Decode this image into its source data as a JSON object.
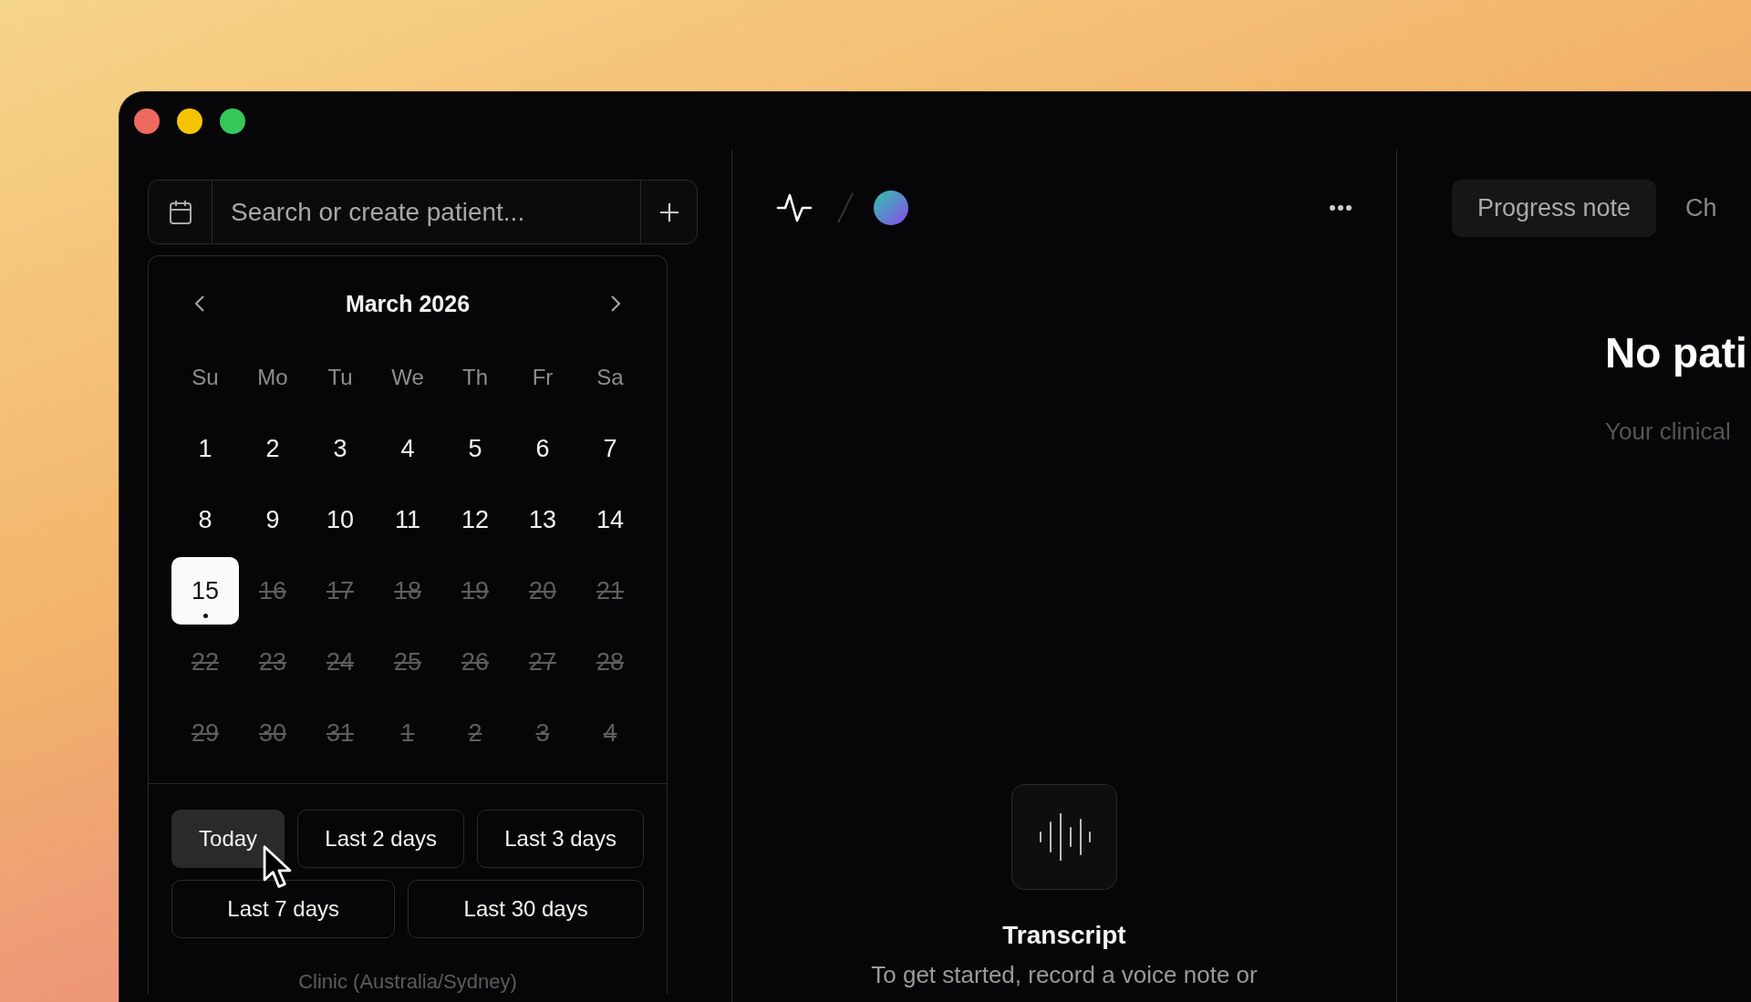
{
  "sidebar": {
    "search": {
      "placeholder": "Search or create patient..."
    },
    "calendar": {
      "month": "March 2026",
      "weekdays": [
        "Su",
        "Mo",
        "Tu",
        "We",
        "Th",
        "Fr",
        "Sa"
      ],
      "weeks": [
        [
          {
            "label": "1",
            "selected": false,
            "disabled": false,
            "dot": false
          },
          {
            "label": "2",
            "selected": false,
            "disabled": false,
            "dot": false
          },
          {
            "label": "3",
            "selected": false,
            "disabled": false,
            "dot": false
          },
          {
            "label": "4",
            "selected": false,
            "disabled": false,
            "dot": false
          },
          {
            "label": "5",
            "selected": false,
            "disabled": false,
            "dot": false
          },
          {
            "label": "6",
            "selected": false,
            "disabled": false,
            "dot": false
          },
          {
            "label": "7",
            "selected": false,
            "disabled": false,
            "dot": false
          }
        ],
        [
          {
            "label": "8",
            "selected": false,
            "disabled": false,
            "dot": false
          },
          {
            "label": "9",
            "selected": false,
            "disabled": false,
            "dot": false
          },
          {
            "label": "10",
            "selected": false,
            "disabled": false,
            "dot": false
          },
          {
            "label": "11",
            "selected": false,
            "disabled": false,
            "dot": false
          },
          {
            "label": "12",
            "selected": false,
            "disabled": false,
            "dot": false
          },
          {
            "label": "13",
            "selected": false,
            "disabled": false,
            "dot": false
          },
          {
            "label": "14",
            "selected": false,
            "disabled": false,
            "dot": false
          }
        ],
        [
          {
            "label": "15",
            "selected": true,
            "disabled": false,
            "dot": true
          },
          {
            "label": "16",
            "selected": false,
            "disabled": true,
            "dot": false
          },
          {
            "label": "17",
            "selected": false,
            "disabled": true,
            "dot": false
          },
          {
            "label": "18",
            "selected": false,
            "disabled": true,
            "dot": false
          },
          {
            "label": "19",
            "selected": false,
            "disabled": true,
            "dot": false
          },
          {
            "label": "20",
            "selected": false,
            "disabled": true,
            "dot": false
          },
          {
            "label": "21",
            "selected": false,
            "disabled": true,
            "dot": false
          }
        ],
        [
          {
            "label": "22",
            "selected": false,
            "disabled": true,
            "dot": false
          },
          {
            "label": "23",
            "selected": false,
            "disabled": true,
            "dot": false
          },
          {
            "label": "24",
            "selected": false,
            "disabled": true,
            "dot": false
          },
          {
            "label": "25",
            "selected": false,
            "disabled": true,
            "dot": false
          },
          {
            "label": "26",
            "selected": false,
            "disabled": true,
            "dot": false
          },
          {
            "label": "27",
            "selected": false,
            "disabled": true,
            "dot": false
          },
          {
            "label": "28",
            "selected": false,
            "disabled": true,
            "dot": false
          }
        ],
        [
          {
            "label": "29",
            "selected": false,
            "disabled": true,
            "dot": false
          },
          {
            "label": "30",
            "selected": false,
            "disabled": true,
            "dot": false
          },
          {
            "label": "31",
            "selected": false,
            "disabled": true,
            "dot": false
          },
          {
            "label": "1",
            "selected": false,
            "disabled": true,
            "dot": false
          },
          {
            "label": "2",
            "selected": false,
            "disabled": true,
            "dot": false
          },
          {
            "label": "3",
            "selected": false,
            "disabled": true,
            "dot": false
          },
          {
            "label": "4",
            "selected": false,
            "disabled": true,
            "dot": false
          }
        ]
      ]
    },
    "ranges": [
      [
        {
          "label": "Today",
          "selected": true
        },
        {
          "label": "Last 2 days",
          "selected": false
        },
        {
          "label": "Last 3 days",
          "selected": false
        }
      ],
      [
        {
          "label": "Last 7 days",
          "selected": false
        },
        {
          "label": "Last 30 days",
          "selected": false
        }
      ]
    ],
    "timezone": "Clinic (Australia/Sydney)"
  },
  "transcript": {
    "title": "Transcript",
    "description": "To get started, record a voice note or"
  },
  "note": {
    "tabs": [
      {
        "label": "Progress note",
        "selected": true
      },
      {
        "label": "Ch",
        "selected": false
      }
    ],
    "heading": "No pati",
    "subtitle": "Your clinical"
  }
}
